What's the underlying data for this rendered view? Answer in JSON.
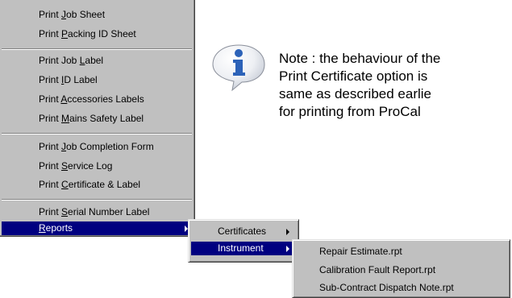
{
  "context_menu": {
    "items": [
      {
        "pre": "Print ",
        "acc": "J",
        "post": "ob Sheet"
      },
      {
        "pre": "Print ",
        "acc": "P",
        "post": "acking ID Sheet"
      },
      {
        "pre": "Print Job ",
        "acc": "L",
        "post": "abel"
      },
      {
        "pre": "Print ",
        "acc": "I",
        "post": "D Label"
      },
      {
        "pre": "Print ",
        "acc": "A",
        "post": "ccessories Labels"
      },
      {
        "pre": "Print ",
        "acc": "M",
        "post": "ains Safety Label"
      },
      {
        "pre": "Print ",
        "acc": "J",
        "post": "ob Completion Form"
      },
      {
        "pre": "Print ",
        "acc": "S",
        "post": "ervice Log"
      },
      {
        "pre": "Print ",
        "acc": "C",
        "post": "ertificate & Label"
      },
      {
        "pre": "Print ",
        "acc": "S",
        "post": "erial Number Label"
      },
      {
        "pre": "",
        "acc": "R",
        "post": "eports"
      }
    ]
  },
  "reports_submenu": {
    "items": [
      {
        "label": "Certificates"
      },
      {
        "label": "Instrument"
      }
    ]
  },
  "instrument_submenu": {
    "items": [
      {
        "label": "Repair Estimate.rpt"
      },
      {
        "label": "Calibration Fault Report.rpt"
      },
      {
        "label": "Sub-Contract Dispatch Note.rpt"
      }
    ]
  },
  "note": {
    "icon": "info-icon",
    "lines": [
      "Note : the behaviour of the",
      "Print Certificate option is",
      "same as described earlie",
      "for printing from ProCal"
    ]
  },
  "colors": {
    "menu_bg": "#c0c0c0",
    "highlight": "#000080",
    "icon_blue": "#2c62b8"
  }
}
